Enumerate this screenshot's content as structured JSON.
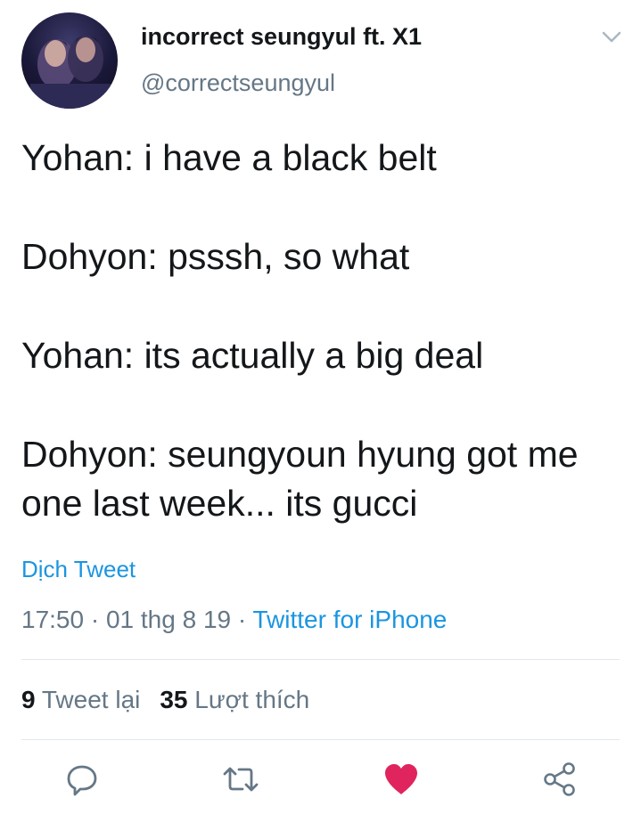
{
  "author": {
    "display_name": "incorrect seungyul ft. X1",
    "handle": "@correctseungyul"
  },
  "tweet": {
    "paragraphs": [
      "Yohan: i have a black belt",
      "Dohyon: psssh, so what",
      "Yohan: its actually a big deal",
      "Dohyon: seungyoun hyung got me one last week... its gucci"
    ],
    "translate_label": "Dịch Tweet",
    "time": "17:50",
    "date": "01 thg 8 19",
    "source": "Twitter for iPhone"
  },
  "stats": {
    "retweet_count": "9",
    "retweet_label": "Tweet lại",
    "like_count": "35",
    "like_label": "Lượt thích"
  },
  "actions": {
    "reply_icon": "reply-icon",
    "retweet_icon": "retweet-icon",
    "like_icon": "heart-icon",
    "share_icon": "share-icon"
  },
  "colors": {
    "accent": "#1b95e0",
    "muted": "#657786",
    "text": "#14171a",
    "like": "#e0245e",
    "divider": "#e1e8ed"
  }
}
